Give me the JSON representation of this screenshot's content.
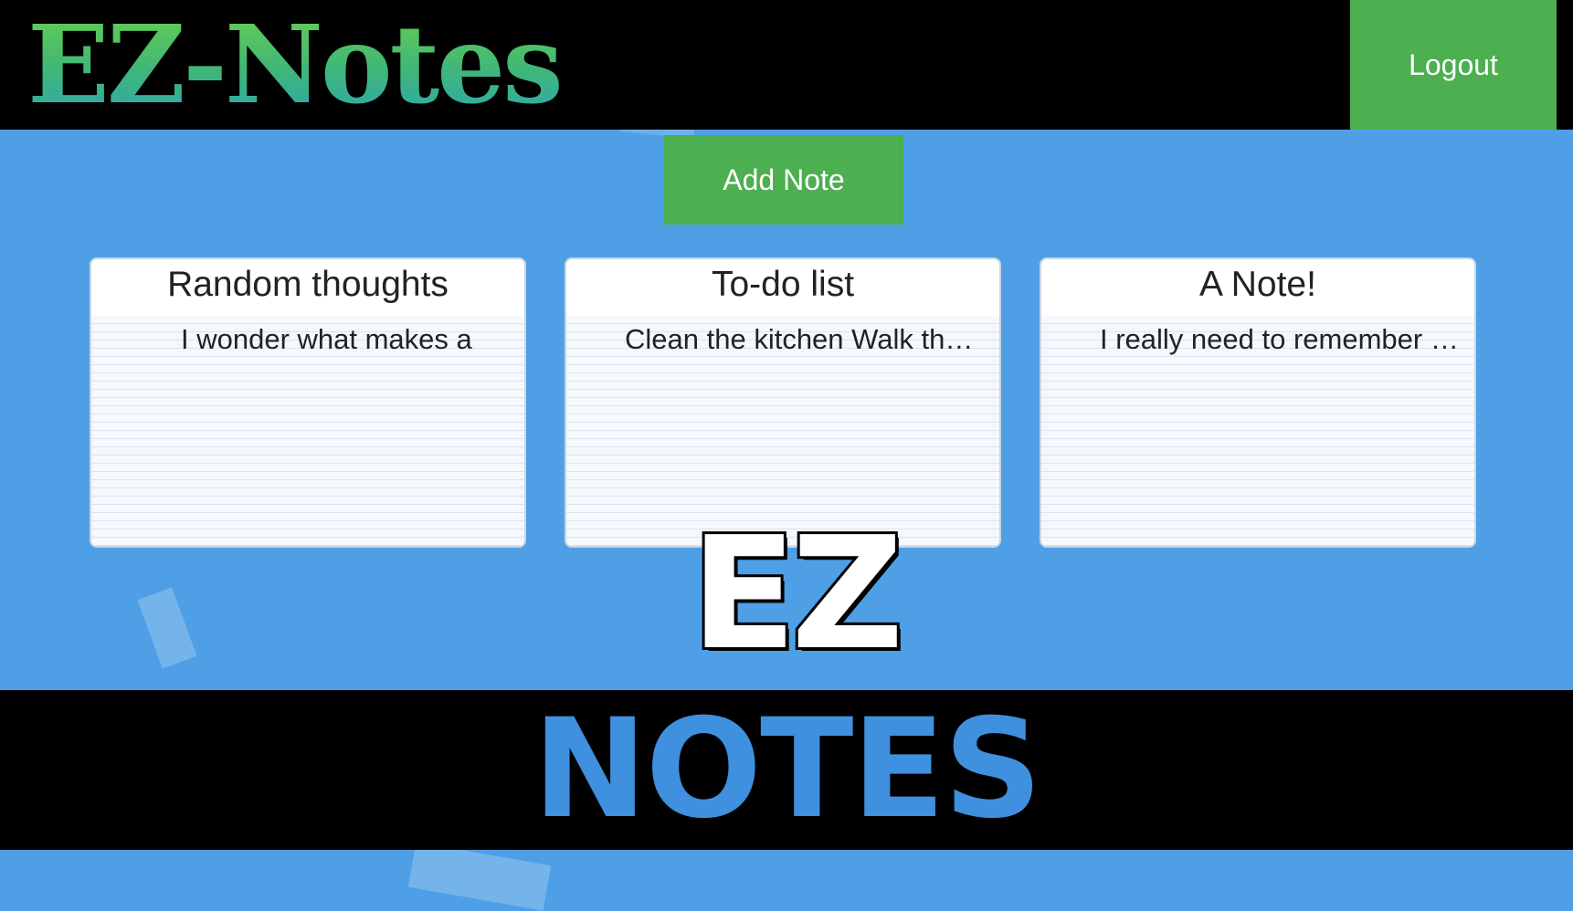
{
  "header": {
    "logo_text": "EZ-Notes",
    "logout_label": "Logout"
  },
  "toolbar": {
    "add_note_label": "Add Note"
  },
  "notes": [
    {
      "title": "Random thoughts",
      "preview": "I wonder what makes a"
    },
    {
      "title": "To-do list",
      "preview": "Clean the kitchen Walk the dog"
    },
    {
      "title": "A Note!",
      "preview": "I really need to remember this"
    }
  ],
  "emblem": {
    "top_text": "EZ",
    "bottom_text": "NOTES"
  },
  "colors": {
    "background": "#4f9fe6",
    "header": "#000000",
    "button_green": "#4caf50",
    "emblem_blue": "#3f90de"
  }
}
